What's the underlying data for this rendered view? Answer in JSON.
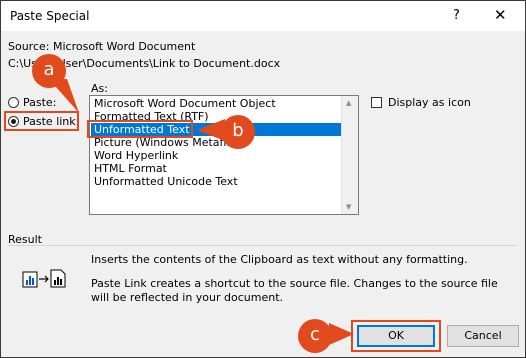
{
  "window": {
    "title": "Paste Special",
    "help_glyph": "?",
    "close_glyph": "✕"
  },
  "source": {
    "label": "Source:",
    "value": "Microsoft Word Document",
    "path": "C:\\Users\\User\\Documents\\Link to Document.docx"
  },
  "options": {
    "paste_label": "Paste:",
    "paste_link_label": "Paste link:",
    "selected": "paste_link"
  },
  "as_list": {
    "label": "As:",
    "items": [
      "Microsoft Word Document Object",
      "Formatted Text (RTF)",
      "Unformatted Text",
      "Picture (Windows Metafile)",
      "Word Hyperlink",
      "HTML Format",
      "Unformatted Unicode Text"
    ],
    "selected_index": 2
  },
  "display_as_icon": {
    "label": "Display as icon",
    "checked": false
  },
  "result": {
    "label": "Result",
    "line1": "Inserts the contents of the Clipboard as text without any formatting.",
    "line2": "Paste Link creates a shortcut to the source file. Changes to the source file will be reflected in your document."
  },
  "buttons": {
    "ok": "OK",
    "cancel": "Cancel"
  },
  "callouts": {
    "a": "a",
    "b": "b",
    "c": "c",
    "color": "#e04a1c"
  },
  "icons": [
    "help-icon",
    "close-icon",
    "radio-icon",
    "checkbox-icon",
    "paste-link-result-icon"
  ]
}
